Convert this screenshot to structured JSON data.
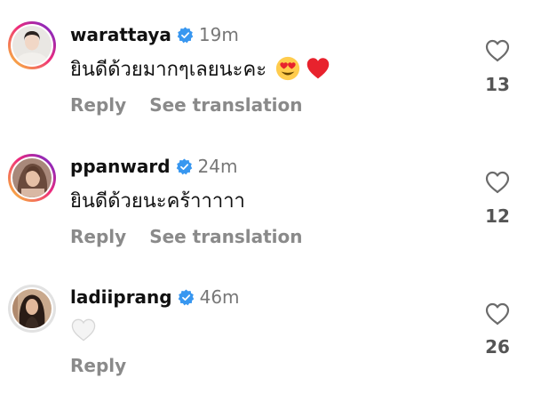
{
  "comments": [
    {
      "username": "warattaya",
      "time": "19m",
      "text": "ยินดีด้วยมากๆเลยนะคะ",
      "emojis": [
        "heart-eyes-emoji",
        "red-heart-emoji"
      ],
      "actions": [
        "Reply",
        "See translation"
      ],
      "likes": "13"
    },
    {
      "username": "ppanward",
      "time": "24m",
      "text": "ยินดีด้วยนะคร้าาาาา",
      "emojis": [],
      "actions": [
        "Reply",
        "See translation"
      ],
      "likes": "12"
    },
    {
      "username": "ladiiprang",
      "time": "46m",
      "text": "",
      "emojis": [
        "white-heart-emoji"
      ],
      "actions": [
        "Reply"
      ],
      "likes": "26"
    }
  ],
  "colors": {
    "verified": "#3897f0",
    "story_ring_start": "#f9ce34",
    "story_ring_end": "#6228d7",
    "muted_text": "#8a8a8a",
    "red_heart": "#e8222d"
  }
}
